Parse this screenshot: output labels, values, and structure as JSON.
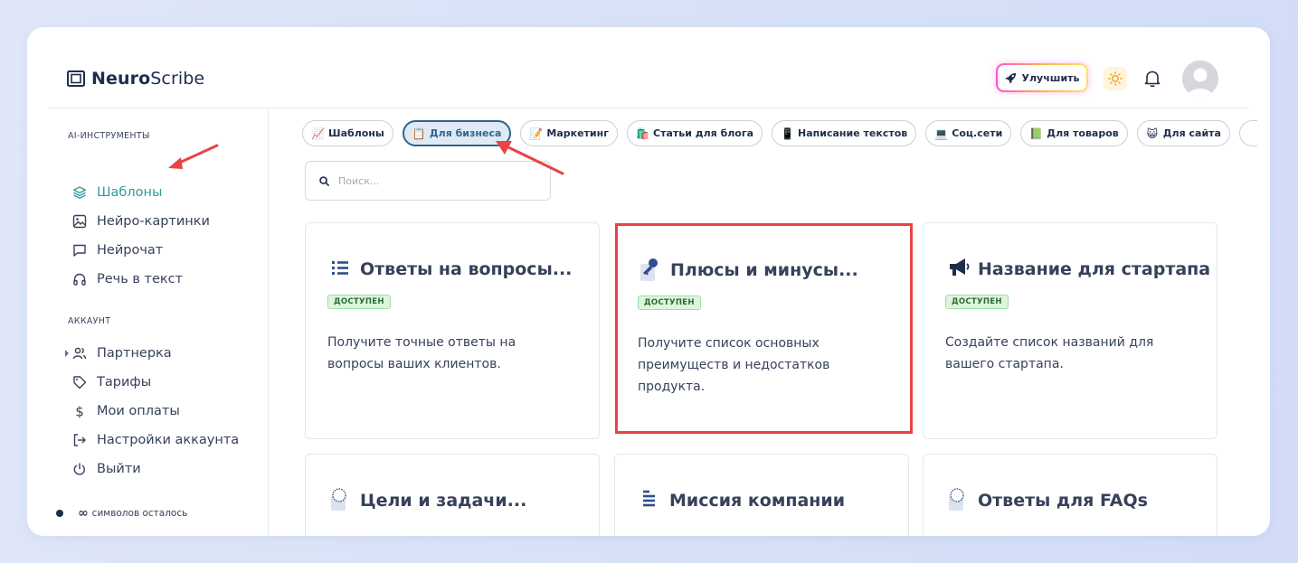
{
  "logo": {
    "bold": "Neuro",
    "regular": "Scribe"
  },
  "header": {
    "upgrade_label": "Улучшить"
  },
  "sidebar": {
    "tools_label": "AI-ИНСТРУМЕНТЫ",
    "tools": [
      {
        "label": "Шаблоны",
        "icon": "layers-icon",
        "active": true
      },
      {
        "label": "Нейро-картинки",
        "icon": "image-icon"
      },
      {
        "label": "Нейрочат",
        "icon": "chat-icon"
      },
      {
        "label": "Речь в текст",
        "icon": "headphones-icon"
      }
    ],
    "account_label": "АККАУНТ",
    "account": [
      {
        "label": "Партнерка",
        "icon": "users-icon"
      },
      {
        "label": "Тарифы",
        "icon": "tag-icon"
      },
      {
        "label": "Мои оплаты",
        "icon": "dollar-icon"
      },
      {
        "label": "Настройки аккаунта",
        "icon": "login-icon"
      },
      {
        "label": "Выйти",
        "icon": "power-icon"
      }
    ],
    "credits_symbol": "∞",
    "credits_label": "символов осталось"
  },
  "categories": [
    {
      "label": "Шаблоны",
      "emoji": "📈"
    },
    {
      "label": "Для бизнеса",
      "emoji": "📋",
      "active": true
    },
    {
      "label": "Маркетинг",
      "emoji": "📝"
    },
    {
      "label": "Статьи для блога",
      "emoji": "🛍️"
    },
    {
      "label": "Написание текстов",
      "emoji": "📱"
    },
    {
      "label": "Соц.сети",
      "emoji": "💻"
    },
    {
      "label": "Для товаров",
      "emoji": "📗"
    },
    {
      "label": "Для сайта",
      "emoji": "😺"
    }
  ],
  "search": {
    "placeholder": "Поиск..."
  },
  "cards": [
    {
      "title": "Ответы на вопросы...",
      "badge": "ДОСТУПЕН",
      "desc": "Получите точные ответы на вопросы ваших клиентов.",
      "icon": "list-icon"
    },
    {
      "title": "Плюсы и минусы...",
      "badge": "ДОСТУПЕН",
      "desc": "Получите список основных преимуществ и недостатков продукта.",
      "icon": "key-icon"
    },
    {
      "title": "Название для стартапа",
      "badge": "ДОСТУПЕН",
      "desc": "Создайте список названий для вашего стартапа.",
      "icon": "megaphone-icon"
    },
    {
      "title": "Цели и задачи...",
      "icon": "circle-icon"
    },
    {
      "title": "Миссия компании",
      "icon": "lines-icon"
    },
    {
      "title": "Ответы для FAQs",
      "icon": "circle-icon"
    }
  ],
  "colors": {
    "accent": "#2f9e9c",
    "highlight": "#e94345",
    "chip_active": "#32628a"
  }
}
